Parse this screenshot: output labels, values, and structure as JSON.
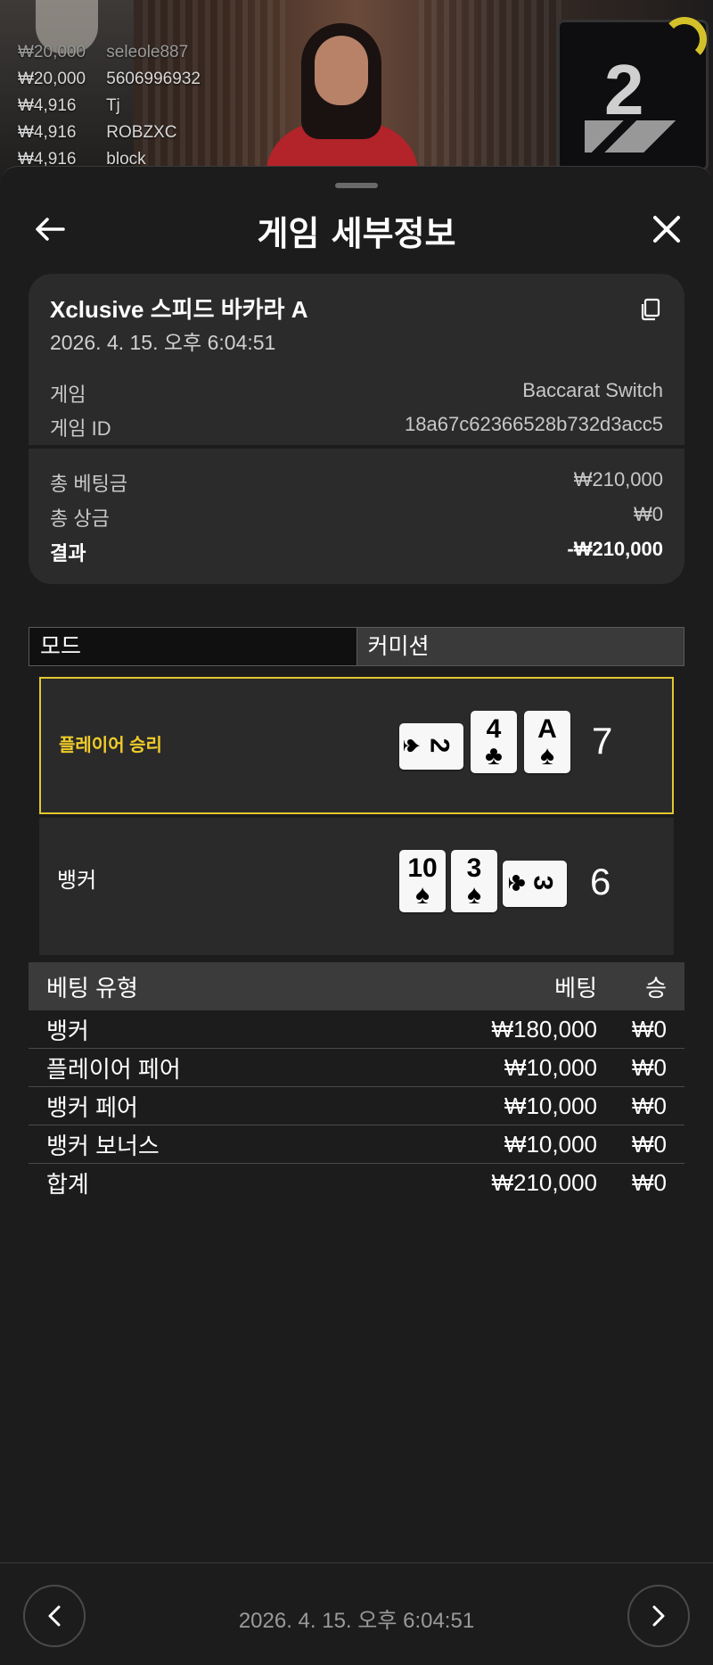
{
  "winners": [
    {
      "amount": "₩20,000",
      "name": "seleole887"
    },
    {
      "amount": "₩20,000",
      "name": "5606996932"
    },
    {
      "amount": "₩4,916",
      "name": "Tj"
    },
    {
      "amount": "₩4,916",
      "name": "ROBZXC"
    },
    {
      "amount": "₩4,916",
      "name": "block"
    }
  ],
  "video": {
    "round_number": "2"
  },
  "header": {
    "title": "게임 세부정보"
  },
  "info": {
    "game_name": "Xclusive 스피드 바카라 A",
    "date": "2026. 4. 15. 오후 6:04:51",
    "game_label": "게임",
    "game_value": "Baccarat Switch",
    "game_id_label": "게임 ID",
    "game_id_value": "18a67c62366528b732d3acc5",
    "total_bet_label": "총 베팅금",
    "total_bet_value": "₩210,000",
    "total_win_label": "총 상금",
    "total_win_value": "₩0",
    "result_label": "결과",
    "result_value": "-₩210,000"
  },
  "mode": {
    "left_label": "모드",
    "right_label": "커미션"
  },
  "results": {
    "player": {
      "label": "플레이어 승리",
      "score": "7",
      "cards": [
        {
          "rank": "2",
          "suit": "♠",
          "orientation": "horizontal"
        },
        {
          "rank": "4",
          "suit": "♣",
          "orientation": "vertical"
        },
        {
          "rank": "A",
          "suit": "♠",
          "orientation": "vertical"
        }
      ]
    },
    "banker": {
      "label": "뱅커",
      "score": "6",
      "cards": [
        {
          "rank": "10",
          "suit": "♠",
          "orientation": "vertical"
        },
        {
          "rank": "3",
          "suit": "♠",
          "orientation": "vertical"
        },
        {
          "rank": "3",
          "suit": "♣",
          "orientation": "horizontal"
        }
      ]
    }
  },
  "bets": {
    "headers": {
      "type": "베팅 유형",
      "bet": "베팅",
      "win": "승"
    },
    "rows": [
      {
        "type": "뱅커",
        "bet": "₩180,000",
        "win": "₩0"
      },
      {
        "type": "플레이어 페어",
        "bet": "₩10,000",
        "win": "₩0"
      },
      {
        "type": "뱅커 페어",
        "bet": "₩10,000",
        "win": "₩0"
      },
      {
        "type": "뱅커 보너스",
        "bet": "₩10,000",
        "win": "₩0"
      }
    ],
    "total": {
      "type": "합계",
      "bet": "₩210,000",
      "win": "₩0"
    }
  },
  "footer": {
    "date": "2026. 4. 15. 오후 6:04:51"
  },
  "colors": {
    "accent": "#f0cc2a",
    "sheet_bg": "#1c1c1c",
    "card_bg": "#2b2b2b"
  }
}
